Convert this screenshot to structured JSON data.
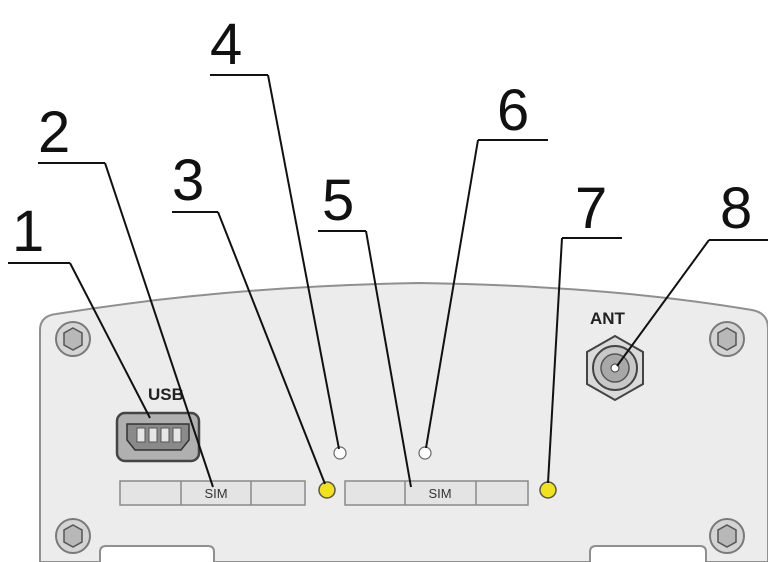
{
  "colors": {
    "panel": "#ececec",
    "panel_edge": "#9a9a9a",
    "led_yellow": "#f2e21a",
    "led_white": "#ffffff",
    "screw": "#b8b8b8"
  },
  "panel": {
    "usb_label": "USB",
    "ant_label": "ANT",
    "sim_label_1": "SIM",
    "sim_label_2": "SIM"
  },
  "callouts": [
    "1",
    "2",
    "3",
    "4",
    "5",
    "6",
    "7",
    "8"
  ],
  "icons": {
    "screws": [
      "screw-icon",
      "screw-icon",
      "screw-icon",
      "screw-icon"
    ],
    "connectors": [
      "usb-port-icon",
      "antenna-connector-icon"
    ]
  }
}
